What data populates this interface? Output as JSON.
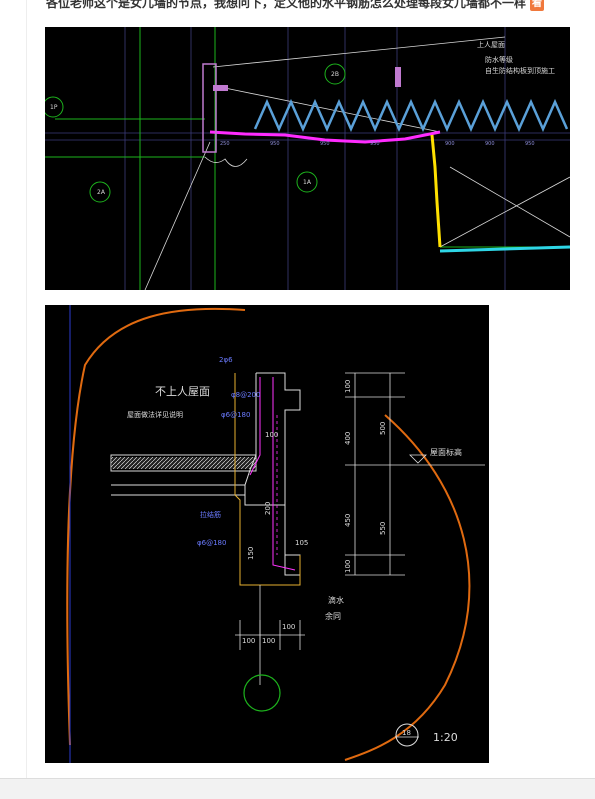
{
  "post": {
    "question": "各位老师这个是女儿墙的节点，我想问下，定义他的水平钢筋怎么处理每段女儿墙都不一样",
    "badge": "看"
  },
  "drawing1": {
    "labels": {
      "roof_label": "上人屋面",
      "waterproof": "防水等级",
      "note1": "自生防结构板到顶施工",
      "g1": "1P",
      "g2": "2A",
      "g3": "2B",
      "g4": "1A"
    }
  },
  "drawing2": {
    "labels": {
      "roof": "不上人屋面",
      "waterproof_layer": "屋面做法详见说明",
      "rebar1": "2φ6",
      "rebar2": "φ8@200",
      "rebar3": "φ6@180",
      "rebar4": "φ6@180",
      "rebar5": "拉结筋",
      "dim_100a": "100",
      "dim_100b": "100",
      "dim_200": "200",
      "dim_150": "150",
      "dim_105": "105",
      "dim_100_top": "100",
      "dim_400": "400",
      "dim_500": "500",
      "dim_450": "450",
      "dim_550": "550",
      "dim_100_bot": "100",
      "dim_b1": "100",
      "dim_b2": "100",
      "dim_b3": "100",
      "roof_elev": "屋面标高",
      "drip": "滴水",
      "drip2": "余同",
      "detail_no": "18",
      "scale": "1:20"
    }
  }
}
